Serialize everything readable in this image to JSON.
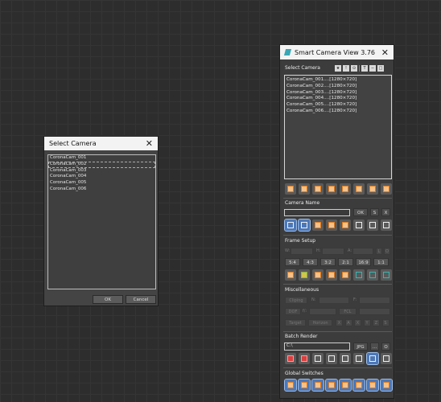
{
  "select_dialog": {
    "title": "Select Camera",
    "close_glyph": "✕",
    "items": [
      "CoronaCam_001",
      "CoronaCam_002",
      "CoronaCam_003",
      "CoronaCam_004",
      "CoronaCam_005",
      "CoronaCam_006"
    ],
    "ok_label": "OK",
    "cancel_label": "Cancel"
  },
  "smart_camera": {
    "title": "Smart Camera View 3.76",
    "close_glyph": "✕",
    "select_camera_label": "Select Camera",
    "top_buttons": [
      "★",
      "!",
      "⊙",
      "T",
      "−",
      "□"
    ],
    "cameras": [
      "CoronaCam_001....[1280×720]",
      "CoronaCam_002....[1280×720]",
      "CoronaCam_003....[1280×720]",
      "CoronaCam_004....[1280×720]",
      "CoronaCam_005....[1280×720]",
      "CoronaCam_006....[1280×720]"
    ],
    "camera_name": {
      "header": "Camera Name",
      "value": "",
      "ok_label": "OK",
      "s_label": "S",
      "x_label": "X"
    },
    "frame_setup": {
      "header": "Frame Setup",
      "w_label": "W:",
      "h_label": "H:",
      "a_label": "A:",
      "l_label": "L",
      "o_label": "O",
      "ratios": [
        "5:4",
        "4:3",
        "3:2",
        "2:1",
        "16:9",
        "1:1"
      ]
    },
    "misc": {
      "header": "Miscellaneous",
      "clipping": "Cliping",
      "n_label": "N:",
      "f_label": "F:",
      "dof": "DOF",
      "fl_label": "f/:",
      "fcl": "FCL",
      "target": "Target",
      "horizon": "Horizon",
      "axes": [
        "X",
        "A",
        "X",
        "Y",
        "Z",
        "S"
      ]
    },
    "batch_render": {
      "header": "Batch Render",
      "path": "C:\\",
      "format": "JPG",
      "browse": "...",
      "open": "O"
    },
    "global_switches": {
      "header": "Global Switches"
    }
  },
  "colors": {
    "viewport_bg": "#2d2d2d",
    "panel_bg": "#3c3c3c",
    "accent_orange": "#e07a1e",
    "accent_blue": "#4d78b7"
  }
}
